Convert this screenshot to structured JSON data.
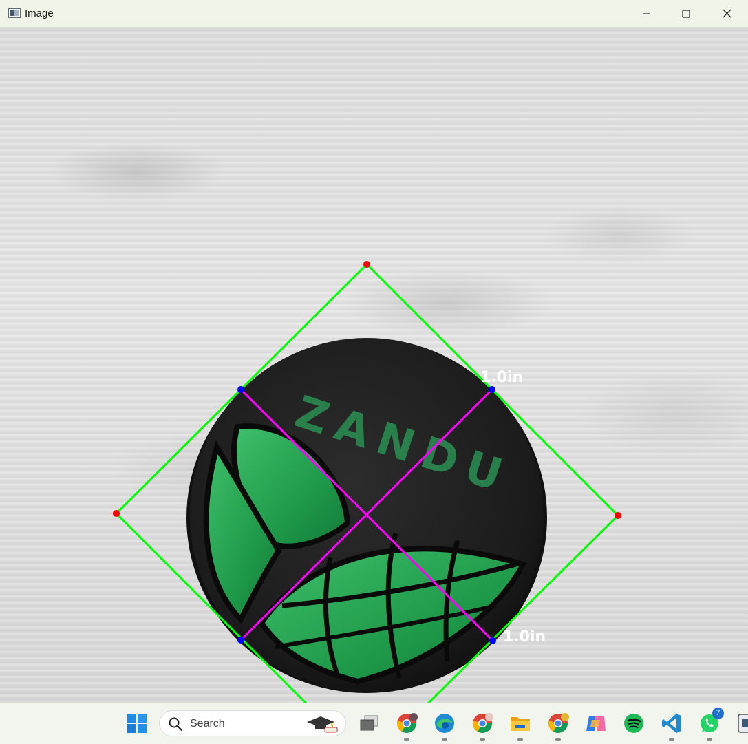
{
  "window": {
    "title": "Image",
    "icon": "image-window-icon",
    "controls": [
      "minimize-icon",
      "maximize-icon",
      "close-icon"
    ]
  },
  "image": {
    "object_text": "ZANDU",
    "measurements": [
      {
        "label": "1.0in",
        "position": "top-right"
      },
      {
        "label": "1.0in",
        "position": "bottom-right"
      }
    ],
    "colors": {
      "box": "#00ff00",
      "corners": "#ff0000",
      "midpoints": "#0000ff",
      "lines": "#ff00ff",
      "labels": "#ffffff"
    }
  },
  "taskbar": {
    "search_placeholder": "Search",
    "apps": [
      {
        "name": "windows-start-icon"
      },
      {
        "name": "task-view-icon"
      },
      {
        "name": "chrome-profile-1-icon"
      },
      {
        "name": "edge-icon"
      },
      {
        "name": "chrome-profile-2-icon"
      },
      {
        "name": "file-explorer-icon"
      },
      {
        "name": "chrome-profile-3-icon"
      },
      {
        "name": "copilot-icon"
      },
      {
        "name": "spotify-icon"
      },
      {
        "name": "vscode-icon"
      },
      {
        "name": "whatsapp-icon",
        "badge": "7"
      }
    ]
  }
}
